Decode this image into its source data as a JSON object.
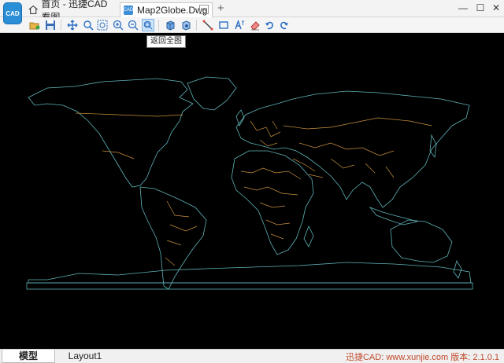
{
  "app": {
    "logo_text": "CAD"
  },
  "tabs": [
    {
      "label": "首页 - 迅捷CAD看图",
      "icon": "home-icon"
    },
    {
      "label": "Map2Globe.Dwg",
      "icon": "dwg-file-icon"
    }
  ],
  "tab_close_glyph": "×",
  "tab_add_glyph": "+",
  "window": {
    "minimize": "—",
    "maximize": "☐",
    "close": "✕"
  },
  "toolbar": {
    "tools": [
      "open-file",
      "save",
      "pan",
      "zoom-window",
      "zoom-select",
      "zoom-in",
      "zoom-out",
      "zoom-extents",
      "3d-box",
      "3d-view",
      "line",
      "rectangle",
      "text",
      "eraser",
      "undo",
      "redo"
    ],
    "active_tool": "zoom-extents",
    "tooltip": "返回全图"
  },
  "layout_tabs": [
    "模型",
    "Layout1"
  ],
  "status": {
    "text": "迅捷CAD: www.xunjie.com 版本: 2.1.0.1"
  },
  "colors": {
    "canvas_bg": "#000000",
    "coastline": "#5fb3b8",
    "borders": "#c8903c"
  }
}
